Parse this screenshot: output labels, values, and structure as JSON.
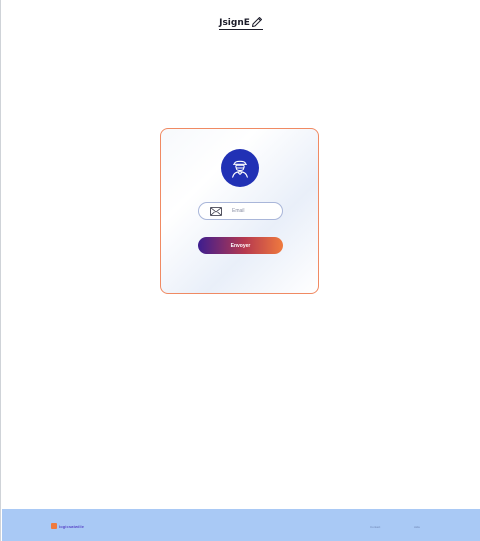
{
  "brand": {
    "name": "JsignE",
    "icon": "pencil-icon"
  },
  "card": {
    "avatar_icon": "user-avatar-icon",
    "email": {
      "icon": "envelope-icon",
      "placeholder": "Email",
      "value": ""
    },
    "submit_label": "Envoyer"
  },
  "footer": {
    "logo_text": "logicsatwille",
    "links": [
      "Contact",
      "Aide"
    ]
  },
  "colors": {
    "accent_blue": "#2131b5",
    "card_border": "#f08a63",
    "button_gradient": [
      "#3d1d8f",
      "#b6394f",
      "#ef7a3e"
    ],
    "footer_bg": "#a9c9f5"
  }
}
